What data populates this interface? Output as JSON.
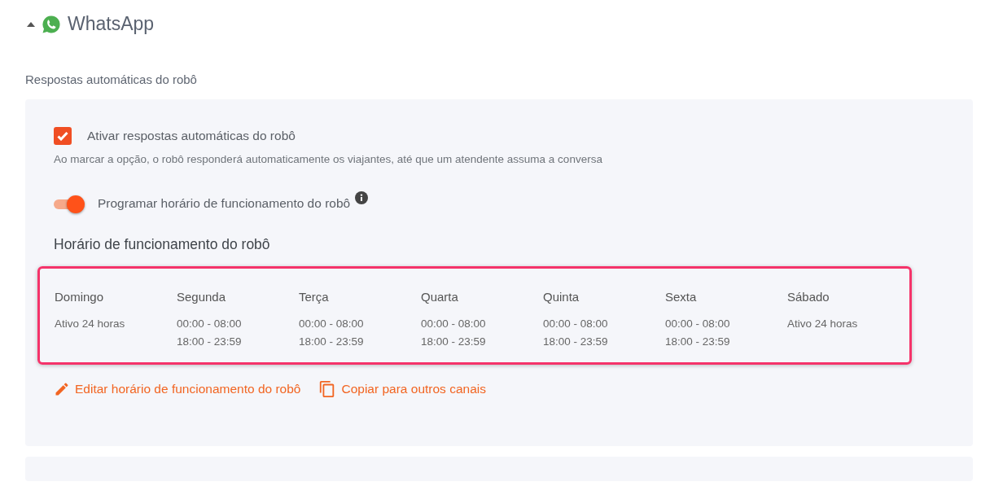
{
  "section": {
    "title": "WhatsApp",
    "expanded": true
  },
  "subtitle": "Respostas automáticas do robô",
  "auto_reply": {
    "label": "Ativar respostas automáticas do robô",
    "checked": true,
    "hint": "Ao marcar a opção, o robô responderá automaticamente os viajantes, até que um atendente assuma a conversa"
  },
  "schedule_toggle": {
    "label": "Programar horário de funcionamento do robô",
    "on": true
  },
  "schedule": {
    "title": "Horário de funcionamento do robô",
    "highlighted": true,
    "days": [
      {
        "name": "Domingo",
        "hours": [
          "Ativo 24 horas"
        ]
      },
      {
        "name": "Segunda",
        "hours": [
          "00:00 - 08:00",
          "18:00 - 23:59"
        ]
      },
      {
        "name": "Terça",
        "hours": [
          "00:00 - 08:00",
          "18:00 - 23:59"
        ]
      },
      {
        "name": "Quarta",
        "hours": [
          "00:00 - 08:00",
          "18:00 - 23:59"
        ]
      },
      {
        "name": "Quinta",
        "hours": [
          "00:00 - 08:00",
          "18:00 - 23:59"
        ]
      },
      {
        "name": "Sexta",
        "hours": [
          "00:00 - 08:00",
          "18:00 - 23:59"
        ]
      },
      {
        "name": "Sábado",
        "hours": [
          "Ativo 24 horas"
        ]
      }
    ]
  },
  "actions": [
    {
      "kind": "edit",
      "label": "Editar horário de funcionamento do robô"
    },
    {
      "kind": "copy",
      "label": "Copiar para outros canais"
    }
  ]
}
